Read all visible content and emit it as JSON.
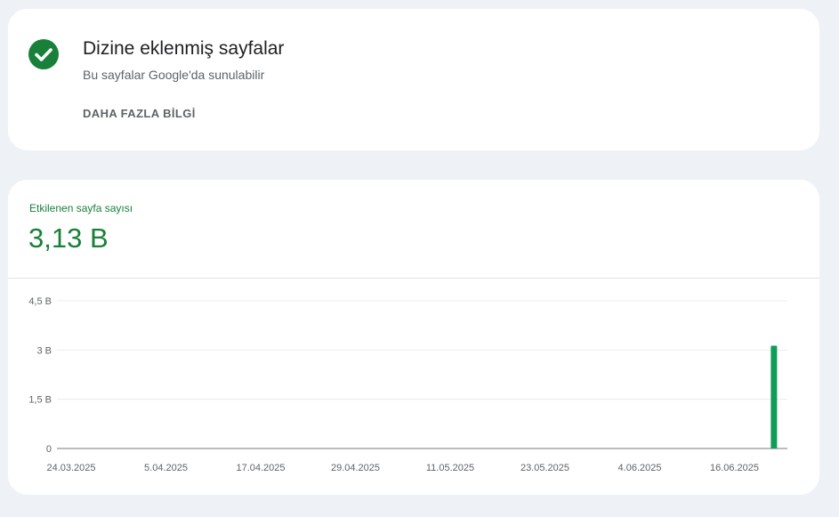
{
  "indexed_card": {
    "icon": "check-circle-icon",
    "title": "Dizine eklenmiş sayfalar",
    "subtitle": "Bu sayfalar Google'da sunulabilir",
    "learn_more": "DAHA FAZLA BİLGİ"
  },
  "metric": {
    "label": "Etkilenen sayfa sayısı",
    "value": "3,13 B"
  },
  "colors": {
    "accent": "#188038",
    "bar": "#0f9d58",
    "background": "#eef2f7"
  },
  "chart_data": {
    "type": "bar",
    "x_tick_labels": [
      "24.03.2025",
      "5.04.2025",
      "17.04.2025",
      "29.04.2025",
      "11.05.2025",
      "23.05.2025",
      "4.06.2025",
      "16.06.2025"
    ],
    "y_tick_labels": [
      "4,5 B",
      "3 B",
      "1,5 B",
      "0"
    ],
    "y_tick_values": [
      4.5,
      3,
      1.5,
      0
    ],
    "ylim": [
      0,
      4.5
    ],
    "x_range": [
      "2025-03-24",
      "2025-06-22"
    ],
    "grid": true,
    "series": [
      {
        "points": [
          {
            "x": "2025-06-21",
            "y": 3.13
          }
        ]
      }
    ]
  }
}
